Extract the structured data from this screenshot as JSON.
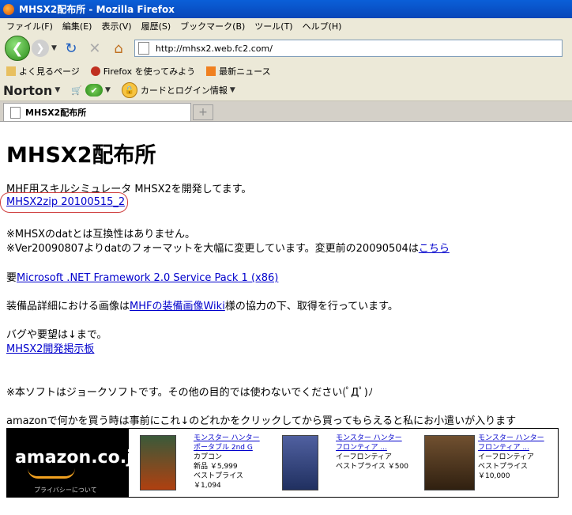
{
  "window": {
    "title": "MHSX2配布所 - Mozilla Firefox"
  },
  "menu": [
    "ファイル(F)",
    "編集(E)",
    "表示(V)",
    "履歴(S)",
    "ブックマーク(B)",
    "ツール(T)",
    "ヘルプ(H)"
  ],
  "nav": {
    "url": "http://mhsx2.web.fc2.com/"
  },
  "bookmarks": [
    "よく見るページ",
    "Firefox を使ってみよう",
    "最新ニュース"
  ],
  "norton": {
    "logo": "Norton",
    "card_label": "カードとログイン情報"
  },
  "tab": {
    "label": "MHSX2配布所"
  },
  "page": {
    "title": "MHSX2配布所",
    "intro": "MHF用スキルシミュレータ MHSX2を開発してます。",
    "download_link": "MHSX2zip 20100515_2",
    "compat1": "※MHSXのdatとは互換性はありません。",
    "compat2_pre": "※Ver20090807よりdatのフォーマットを大幅に変更しています。変更前の20090504は",
    "compat2_link": "こちら",
    "req_pre": "要",
    "req_link": "Microsoft .NET Framework 2.0 Service Pack 1 (x86)",
    "equip_pre": "装備品詳細における画像は",
    "equip_link": "MHFの装備画像Wiki",
    "equip_post": "様の協力の下、取得を行っています。",
    "bug_text": "バグや要望は↓まで。",
    "bug_link": "MHSX2開発掲示板",
    "joke": "※本ソフトはジョークソフトです。その他の目的では使わないでください(ﾟДﾟ)ﾉ",
    "amazon_msg": "amazonで何かを買う時は事前にこれ↓のどれかをクリックしてから買ってもらえると私にお小遣いが入ります"
  },
  "amazon": {
    "brand": "amazon.co.jp",
    "privacy": "プライバシーについて",
    "products": [
      {
        "title1": "モンスター ハンター",
        "title2": "ポータブル 2nd G",
        "maker": "カプコン",
        "line3": "新品 ￥5,999",
        "line4": "ベストプライス",
        "line5": "￥1,094"
      },
      {
        "title1": "モンスター ハンター",
        "title2": "フロンティア ...",
        "maker": "イーフロンティア",
        "line3": "ベストプライス ￥500",
        "line4": "",
        "line5": ""
      },
      {
        "title1": "モンスター ハンター",
        "title2": "フロンティア ...",
        "maker": "イーフロンティア",
        "line3": "ベストプライス",
        "line4": "￥10,000",
        "line5": ""
      }
    ]
  }
}
